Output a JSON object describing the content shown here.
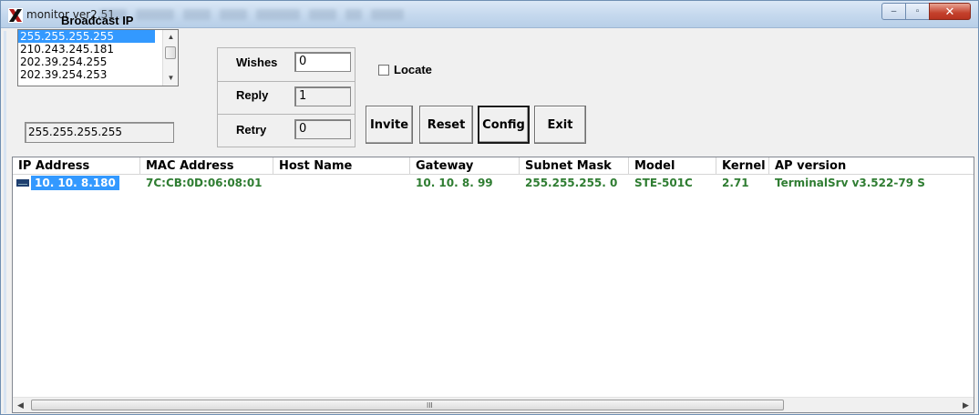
{
  "window": {
    "title": "monitor ver2.51",
    "caption": {
      "minimize": "–",
      "maximize": "▫",
      "close": "✕"
    }
  },
  "broadcast": {
    "label": "Broadcast IP",
    "options": [
      "255.255.255.255",
      "210.243.245.181",
      "202.39.254.255",
      "202.39.254.253"
    ],
    "selected_value": "255.255.255.255"
  },
  "stats": {
    "wishes_label": "Wishes",
    "wishes_value": "0",
    "reply_label": "Reply",
    "reply_value": "1",
    "retry_label": "Retry",
    "retry_value": "0"
  },
  "locate": {
    "label": "Locate",
    "checked": false
  },
  "buttons": {
    "invite": "Invite",
    "reset": "Reset",
    "config": "Config",
    "exit": "Exit"
  },
  "device_list": {
    "columns": [
      "IP Address",
      "MAC Address",
      "Host Name",
      "Gateway",
      "Subnet Mask",
      "Model",
      "Kernel",
      "AP version"
    ],
    "rows": [
      {
        "ip": "10. 10.  8.180",
        "mac": "7C:CB:0D:06:08:01",
        "host": "",
        "gateway": "10. 10.  8. 99",
        "subnet": "255.255.255.  0",
        "model": "STE-501C",
        "kernel": "2.71",
        "ap_version": "TerminalSrv v3.522-79   S"
      }
    ],
    "scroll_grip": "III"
  },
  "colors": {
    "row_text": "#2f7d32",
    "selection": "#3399ff"
  }
}
